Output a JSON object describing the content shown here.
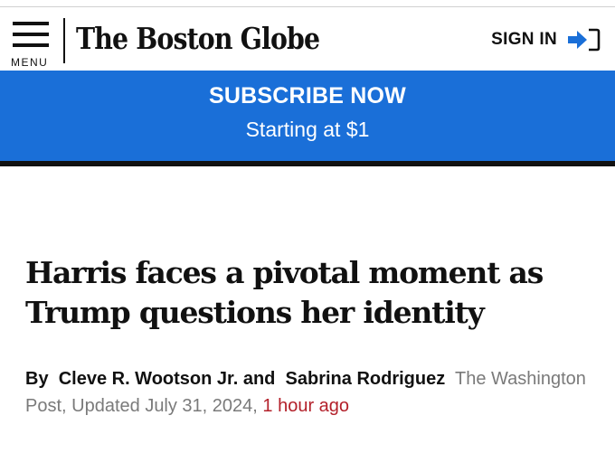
{
  "header": {
    "menu_label": "MENU",
    "logo_text": "The Boston Globe",
    "sign_in_label": "SIGN IN",
    "sign_in_icon": "sign-in-arrow-icon",
    "accent_color": "#1a6fd8"
  },
  "subscribe": {
    "title": "SUBSCRIBE NOW",
    "subtitle": "Starting at $1",
    "background_color": "#1a6fd8"
  },
  "article": {
    "headline": "Harris faces a pivotal moment as Trump questions her identity",
    "byline": {
      "by": "By",
      "author_1": "Cleve R. Wootson Jr.",
      "and": "and",
      "author_2": "Sabrina Rodriguez",
      "source": "The Washington Post,",
      "updated": "Updated July 31, 2024,",
      "time_ago": "1 hour ago",
      "time_ago_color": "#b3202a"
    }
  }
}
